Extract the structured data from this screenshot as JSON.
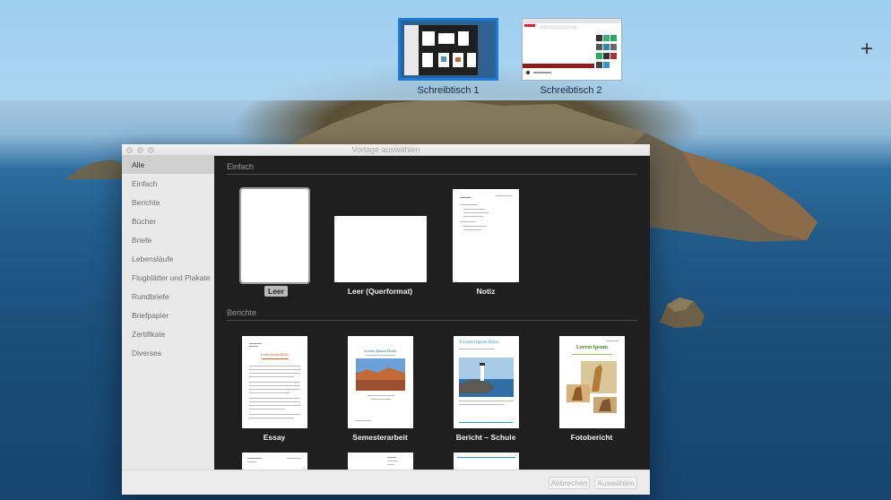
{
  "spaces": {
    "desktops": [
      {
        "label": "Schreibtisch 1"
      },
      {
        "label": "Schreibtisch 2"
      }
    ],
    "add_label": "+"
  },
  "dialog": {
    "title": "Vorlage auswählen",
    "sidebar": [
      "Alle",
      "Einfach",
      "Berichte",
      "Bücher",
      "Briefe",
      "Lebensläufe",
      "Flugblätter und Plakate",
      "Rundbriefe",
      "Briefpapier",
      "Zertifikate",
      "Diverses"
    ],
    "sections": [
      {
        "title": "Einfach",
        "templates": [
          "Leer",
          "Leer (Querformat)",
          "Notiz"
        ]
      },
      {
        "title": "Berichte",
        "templates": [
          "Essay",
          "Semesterarbeit",
          "Bericht – Schule",
          "Fotobericht"
        ]
      }
    ],
    "thumb_text": {
      "essay_title": "Lorem Ipsum Dolor",
      "semester_title": "Lorem Ipsum Dolor",
      "bericht_title": "A Lorem Ipsum Dolor",
      "foto_title": "Lorem Ipsum"
    },
    "buttons": {
      "cancel": "Abbrechen",
      "choose": "Auswählen"
    }
  },
  "colors": {
    "selection_outline": "#1c7ad8",
    "content_bg": "#1f1f1f",
    "sidebar_bg": "#e9e9e9"
  }
}
